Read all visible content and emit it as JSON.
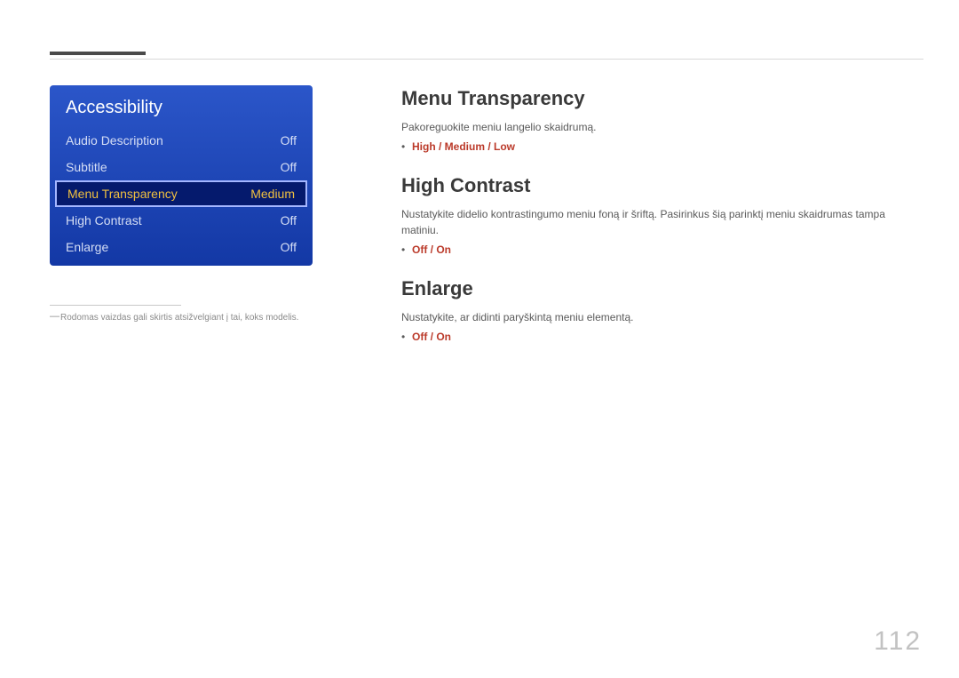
{
  "menu": {
    "title": "Accessibility",
    "rows": [
      {
        "label": "Audio Description",
        "value": "Off"
      },
      {
        "label": "Subtitle",
        "value": "Off"
      },
      {
        "label": "Menu Transparency",
        "value": "Medium"
      },
      {
        "label": "High Contrast",
        "value": "Off"
      },
      {
        "label": "Enlarge",
        "value": "Off"
      }
    ]
  },
  "footnote": "Rodomas vaizdas gali skirtis atsižvelgiant į tai, koks modelis.",
  "sections": {
    "s1": {
      "title": "Menu Transparency",
      "desc": "Pakoreguokite meniu langelio skaidrumą.",
      "options": "High / Medium / Low"
    },
    "s2": {
      "title": "High Contrast",
      "desc": "Nustatykite didelio kontrastingumo meniu foną ir šriftą. Pasirinkus šią parinktį meniu skaidrumas tampa matiniu.",
      "options": "Off / On"
    },
    "s3": {
      "title": "Enlarge",
      "desc": "Nustatykite, ar didinti paryškintą meniu elementą.",
      "options": "Off / On"
    }
  },
  "page_number": "112"
}
